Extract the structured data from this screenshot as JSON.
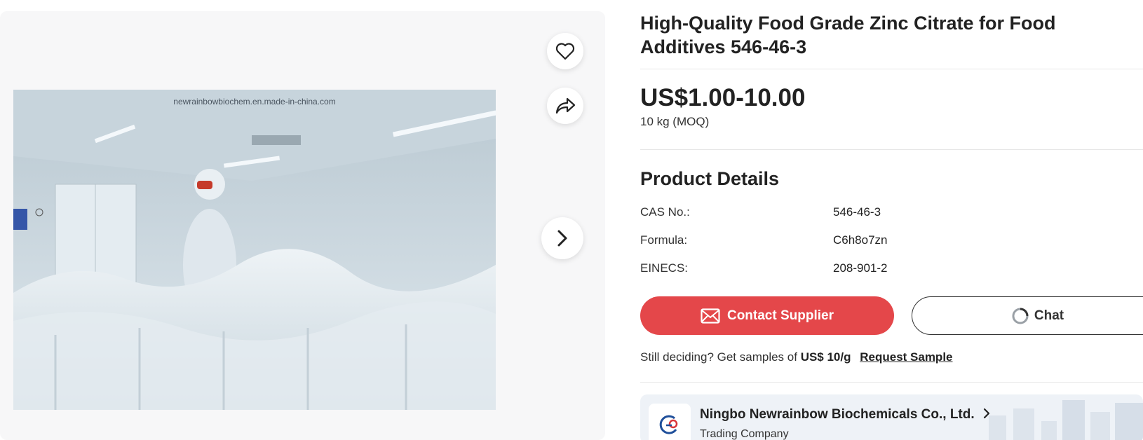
{
  "gallery": {
    "watermark": "newrainbowbiochem.en.made-in-china.com"
  },
  "product": {
    "title": "High-Quality Food Grade Zinc Citrate for Food Additives 546-46-3",
    "price": "US$1.00-10.00",
    "moq": "10 kg (MOQ)"
  },
  "details": {
    "heading": "Product Details",
    "rows": [
      {
        "label": "CAS No.:",
        "value": "546-46-3"
      },
      {
        "label": "Formula:",
        "value": "C6h8o7zn"
      },
      {
        "label": "EINECS:",
        "value": "208-901-2"
      }
    ]
  },
  "actions": {
    "contact_label": "Contact Supplier",
    "chat_label": "Chat"
  },
  "sample": {
    "prefix": "Still deciding? Get samples of",
    "price": "US$ 10/g",
    "link": "Request Sample"
  },
  "supplier": {
    "name": "Ningbo Newrainbow Biochemicals Co., Ltd.",
    "type": "Trading Company"
  },
  "colors": {
    "accent": "#e4474a",
    "text": "#222222",
    "card_bg": "#eef2f7"
  },
  "icons": {
    "favorite": "heart-icon",
    "share": "share-icon",
    "next": "chevron-right-icon",
    "contact": "mail-icon",
    "chat": "chat-icon",
    "supplier_arrow": "chevron-right-icon"
  }
}
